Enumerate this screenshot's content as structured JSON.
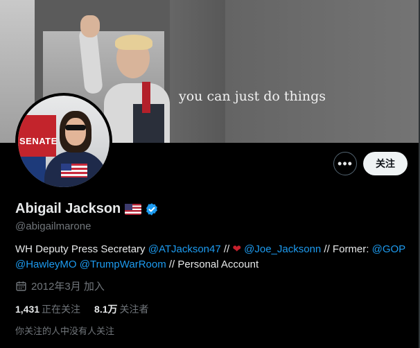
{
  "banner": {
    "text": "you can just do things"
  },
  "avatar": {
    "sign_text": "SENATE"
  },
  "actions": {
    "more_label": "•••",
    "follow_label": "关注"
  },
  "profile": {
    "name": "Abigail Jackson",
    "handle": "@abigailmarone"
  },
  "bio": {
    "line1": [
      "WH Deputy Press Secretary ",
      "@ATJackson47",
      " // ",
      "❤",
      " ",
      "@Joe_Jacksonn",
      " // Former: ",
      "@GOP"
    ],
    "line2": [
      "@HawleyMO",
      " ",
      "@TrumpWarRoom",
      " // Personal Account"
    ]
  },
  "joined": {
    "text": "2012年3月 加入"
  },
  "stats": {
    "following_count": "1,431",
    "following_label": "正在关注",
    "followers_count": "8.1万",
    "followers_label": "关注者"
  },
  "mutuals": {
    "text": "你关注的人中没有人关注"
  },
  "colors": {
    "background": "#000000",
    "link": "#1d9bf0",
    "muted": "#71767b",
    "verified": "#1d9bf0"
  }
}
